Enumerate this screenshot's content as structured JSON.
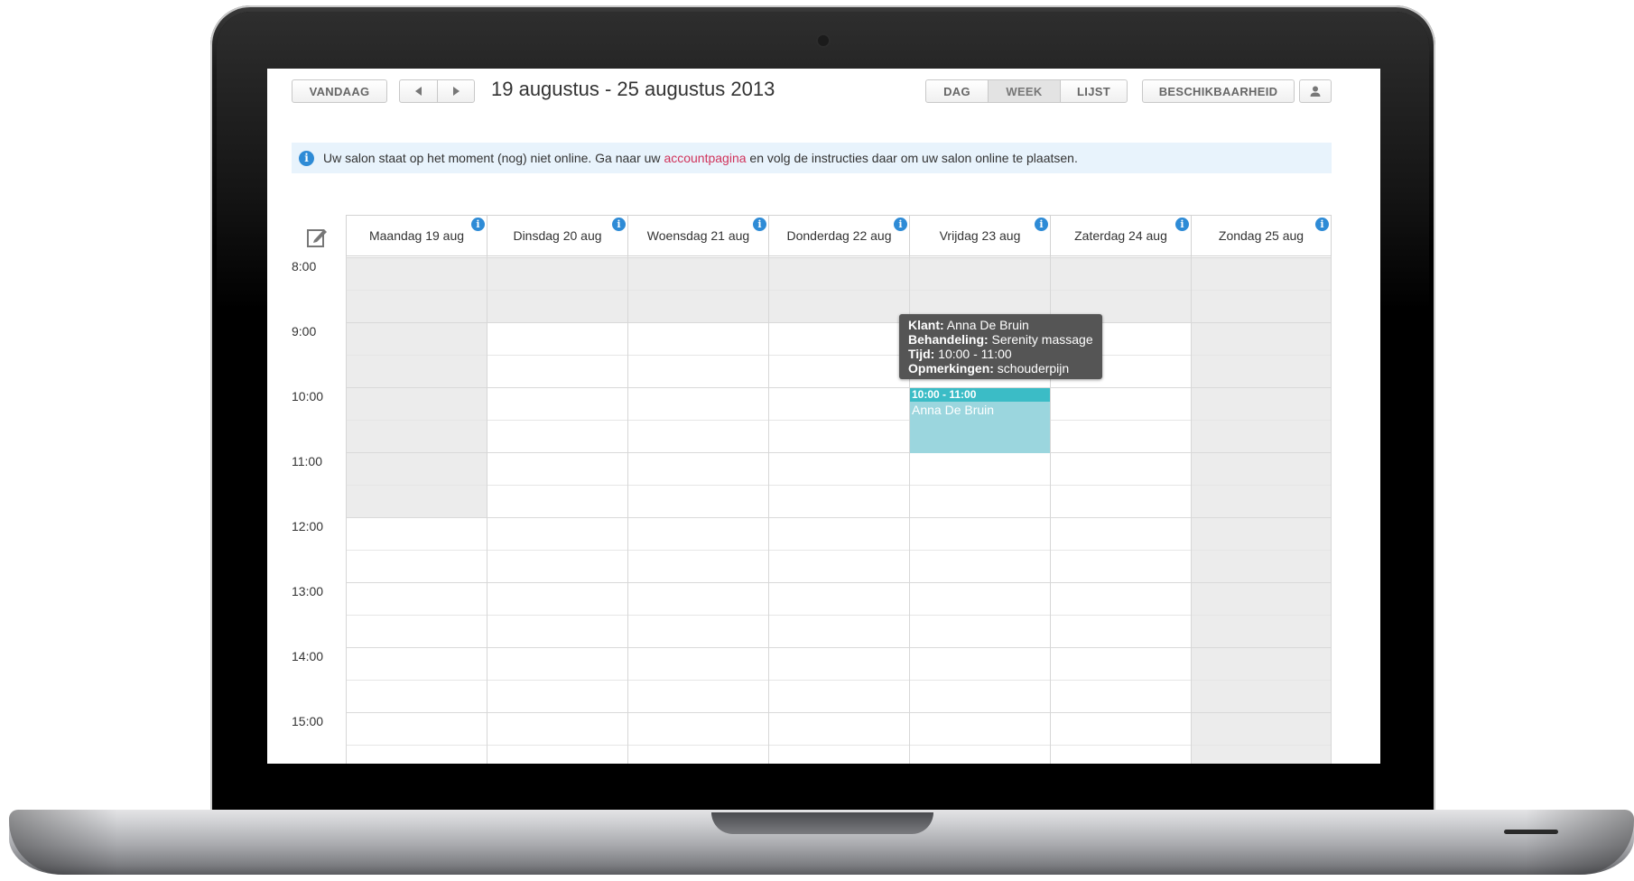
{
  "toolbar": {
    "today_label": "VANDAAG",
    "prev_icon": "triangle-left-icon",
    "next_icon": "triangle-right-icon",
    "date_range": "19 augustus - 25 augustus 2013",
    "view_tabs": [
      {
        "label": "DAG",
        "active": false
      },
      {
        "label": "WEEK",
        "active": true
      },
      {
        "label": "LIJST",
        "active": false
      }
    ],
    "availability_label": "BESCHIKBAARHEID",
    "user_icon": "person-icon"
  },
  "notice": {
    "text_before": "Uw salon staat op het moment (nog) niet online. Ga naar uw ",
    "link_text": "accountpagina",
    "text_after": " en volg de instructies daar om uw salon online te plaatsen."
  },
  "calendar": {
    "days": [
      {
        "label": "Maandag 19 aug"
      },
      {
        "label": "Dinsdag 20 aug"
      },
      {
        "label": "Woensdag 21 aug"
      },
      {
        "label": "Donderdag 22 aug"
      },
      {
        "label": "Vrijdag 23 aug"
      },
      {
        "label": "Zaterdag 24 aug"
      },
      {
        "label": "Zondag 25 aug"
      }
    ],
    "times": [
      "8:00",
      "9:00",
      "10:00",
      "11:00",
      "12:00",
      "13:00",
      "14:00",
      "15:00"
    ],
    "event": {
      "time": "10:00 - 11:00",
      "client": "Anna De Bruin"
    },
    "tooltip": {
      "client_label": "Klant:",
      "client_value": " Anna De Bruin",
      "treatment_label": "Behandeling:",
      "treatment_value": " Serenity massage",
      "time_label": "Tijd:",
      "time_value": " 10:00 - 11:00",
      "notes_label": "Opmerkingen:",
      "notes_value": " schouderpijn"
    }
  },
  "colors": {
    "accent_blue": "#2e8bd6",
    "event_bg": "#9bd6de",
    "event_header": "#3bbcc6",
    "link": "#d0335b",
    "unavailable": "#ececec"
  }
}
